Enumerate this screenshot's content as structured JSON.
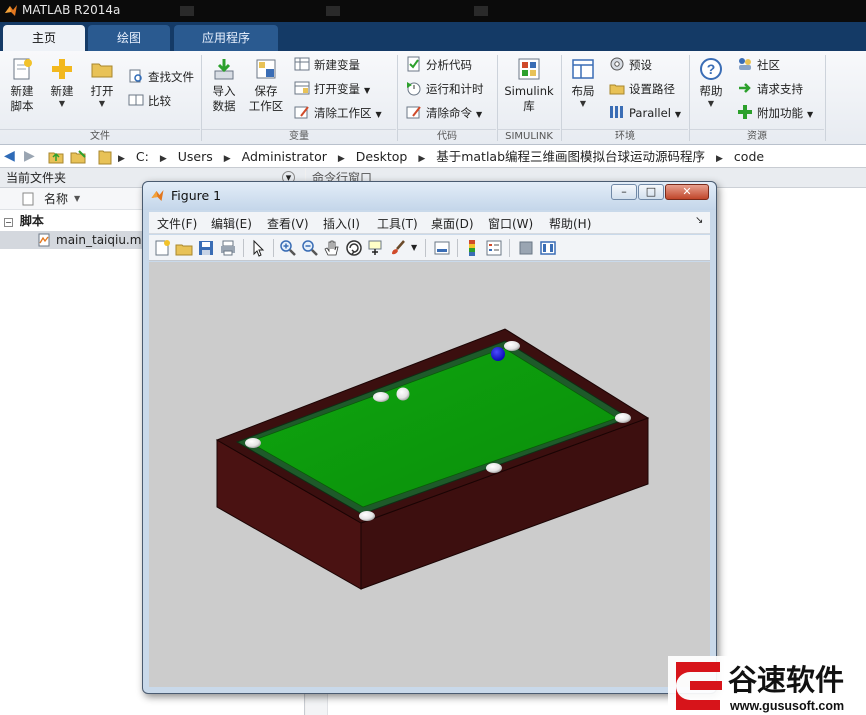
{
  "window": {
    "title": "MATLAB R2014a"
  },
  "tabs": [
    {
      "label": "主页",
      "active": true
    },
    {
      "label": "绘图",
      "active": false
    },
    {
      "label": "应用程序",
      "active": false
    }
  ],
  "ribbon": {
    "groups": {
      "file": "文件",
      "variable": "变量",
      "code": "代码",
      "simulink": "SIMULINK",
      "env": "环境",
      "resource": "资源"
    },
    "file": {
      "new_script": [
        "新建",
        "脚本"
      ],
      "new": "新建",
      "open": "打开",
      "find_files": "查找文件",
      "compare": "比较"
    },
    "variable": {
      "import": [
        "导入",
        "数据"
      ],
      "save": [
        "保存",
        "工作区"
      ],
      "new_var": "新建变量",
      "open_var": "打开变量",
      "clear_ws": "清除工作区"
    },
    "code": {
      "analyze": "分析代码",
      "run_time": "运行和计时",
      "clear_cmd": "清除命令"
    },
    "simulink": {
      "lib": [
        "Simulink",
        "库"
      ]
    },
    "env": {
      "layout": "布局",
      "prefs": "预设",
      "set_path": "设置路径",
      "parallel": "Parallel"
    },
    "resource": {
      "help": "帮助",
      "community": "社区",
      "support": "请求支持",
      "addons": "附加功能"
    }
  },
  "path": {
    "crumbs": [
      "C:",
      "Users",
      "Administrator",
      "Desktop",
      "基于matlab编程三维画图模拟台球运动源码程序",
      "code"
    ]
  },
  "left_pane": {
    "title": "当前文件夹",
    "column": "名称",
    "folder": "脚本",
    "file": "main_taiqiu.m"
  },
  "right_pane": {
    "title": "命令行窗口"
  },
  "figure": {
    "title": "Figure 1",
    "menu": [
      "文件(F)",
      "编辑(E)",
      "查看(V)",
      "插入(I)",
      "工具(T)",
      "桌面(D)",
      "窗口(W)",
      "帮助(H)"
    ],
    "colors": {
      "felt": "#0b9a0b",
      "felt_shade": "#0a8a0a",
      "cushion": "#1e5a2a",
      "rail": "#3b0f0f",
      "rail_side": "#4a1212",
      "cue_ball": "#1414e6",
      "ball": "#f2f2f2"
    }
  },
  "watermark": {
    "brand": "谷速软件",
    "url": "www.gususoft.com"
  }
}
